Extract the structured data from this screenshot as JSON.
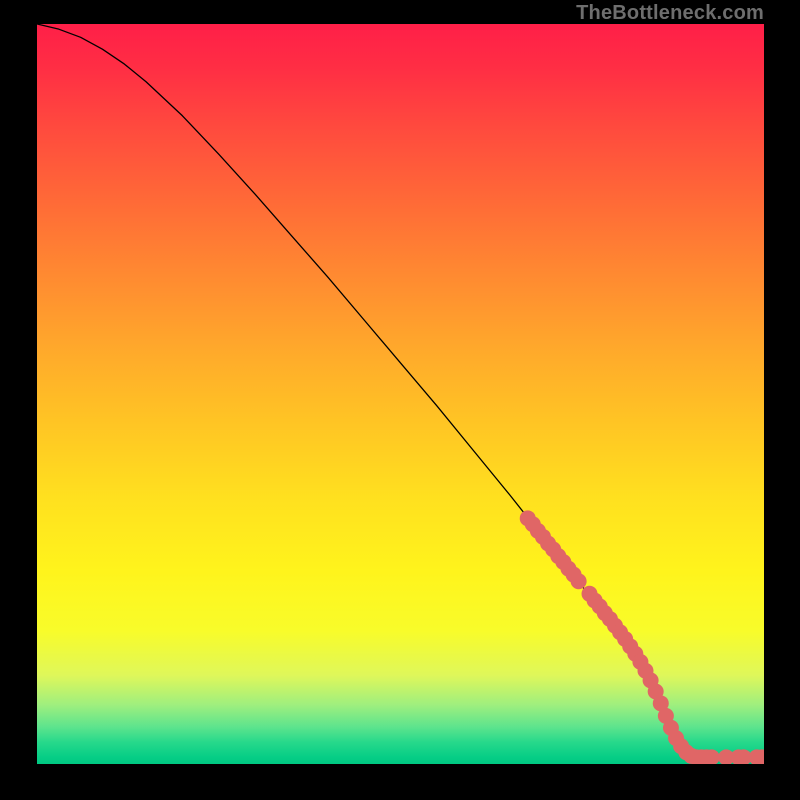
{
  "watermark": "TheBottleneck.com",
  "colors": {
    "page_bg": "#000000",
    "line": "#000000",
    "marker": "#e06666",
    "gradient_top": "#ff1f48",
    "gradient_bottom": "#00c882"
  },
  "chart_data": {
    "type": "line",
    "title": "",
    "xlabel": "",
    "ylabel": "",
    "xlim": [
      0,
      100
    ],
    "ylim": [
      0,
      100
    ],
    "grid": false,
    "series": [
      {
        "name": "curve",
        "x": [
          0,
          3,
          6,
          9,
          12,
          15,
          20,
          25,
          30,
          35,
          40,
          45,
          50,
          55,
          60,
          65,
          70,
          75,
          80,
          82,
          84,
          85,
          86,
          88,
          90,
          92,
          94,
          96,
          98,
          100
        ],
        "y": [
          100,
          99.3,
          98.2,
          96.6,
          94.6,
          92.2,
          87.6,
          82.4,
          77.0,
          71.4,
          65.8,
          60.0,
          54.2,
          48.4,
          42.4,
          36.4,
          30.2,
          24.0,
          17.6,
          14.8,
          11.8,
          10.0,
          8.0,
          4.2,
          1.8,
          0.9,
          0.9,
          0.9,
          0.9,
          0.9
        ]
      }
    ],
    "markers": {
      "name": "highlighted-points",
      "color": "#e06666",
      "radius": 1.1,
      "x": [
        67.5,
        68.2,
        68.9,
        69.6,
        70.3,
        71.0,
        71.7,
        72.4,
        73.1,
        73.8,
        74.5,
        76.0,
        76.7,
        77.4,
        78.1,
        78.8,
        79.5,
        80.2,
        80.9,
        81.6,
        82.3,
        83.0,
        83.7,
        84.4,
        85.1,
        85.8,
        86.5,
        87.2,
        87.9,
        88.6,
        89.3,
        90.0,
        90.7,
        91.4,
        92.1,
        92.8,
        94.8,
        96.5,
        97.2,
        99.0,
        99.7
      ],
      "y": [
        33.2,
        32.4,
        31.5,
        30.7,
        29.8,
        29.0,
        28.1,
        27.3,
        26.4,
        25.6,
        24.7,
        23.0,
        22.1,
        21.3,
        20.4,
        19.6,
        18.7,
        17.8,
        16.9,
        15.9,
        14.9,
        13.8,
        12.6,
        11.3,
        9.8,
        8.2,
        6.5,
        4.9,
        3.5,
        2.4,
        1.6,
        1.1,
        0.9,
        0.9,
        0.9,
        0.9,
        0.9,
        0.9,
        0.9,
        0.9,
        0.9
      ]
    }
  }
}
